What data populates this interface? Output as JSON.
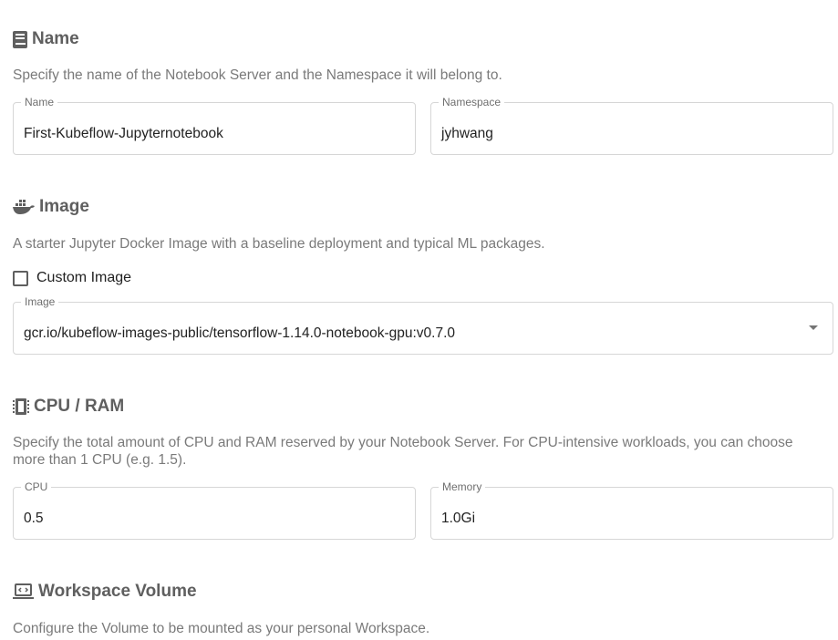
{
  "name_section": {
    "title": "Name",
    "icon": "book-icon",
    "description": "Specify the name of the Notebook Server and the Namespace it will belong to.",
    "name_label": "Name",
    "name_value": "First-Kubeflow-Jupyternotebook",
    "namespace_label": "Namespace",
    "namespace_value": "jyhwang"
  },
  "image_section": {
    "title": "Image",
    "icon": "docker-icon",
    "description": "A starter Jupyter Docker Image with a baseline deployment and typical ML packages.",
    "custom_image_label": "Custom Image",
    "custom_image_checked": false,
    "image_label": "Image",
    "image_value": "gcr.io/kubeflow-images-public/tensorflow-1.14.0-notebook-gpu:v0.7.0"
  },
  "cpu_section": {
    "title": "CPU / RAM",
    "icon": "chip-icon",
    "description_line1": "Specify the total amount of CPU and RAM reserved by your Notebook Server. For CPU-intensive workloads, you can choose",
    "description_line2": "more than 1 CPU (e.g. 1.5).",
    "cpu_label": "CPU",
    "cpu_value": "0.5",
    "memory_label": "Memory",
    "memory_value": "1.0Gi"
  },
  "workspace_section": {
    "title": "Workspace Volume",
    "icon": "laptop-icon",
    "description": "Configure the Volume to be mounted as your personal Workspace."
  },
  "colors": {
    "heading": "#5f5f5f",
    "description": "#7a7a7a",
    "border": "#d6d6d6"
  }
}
